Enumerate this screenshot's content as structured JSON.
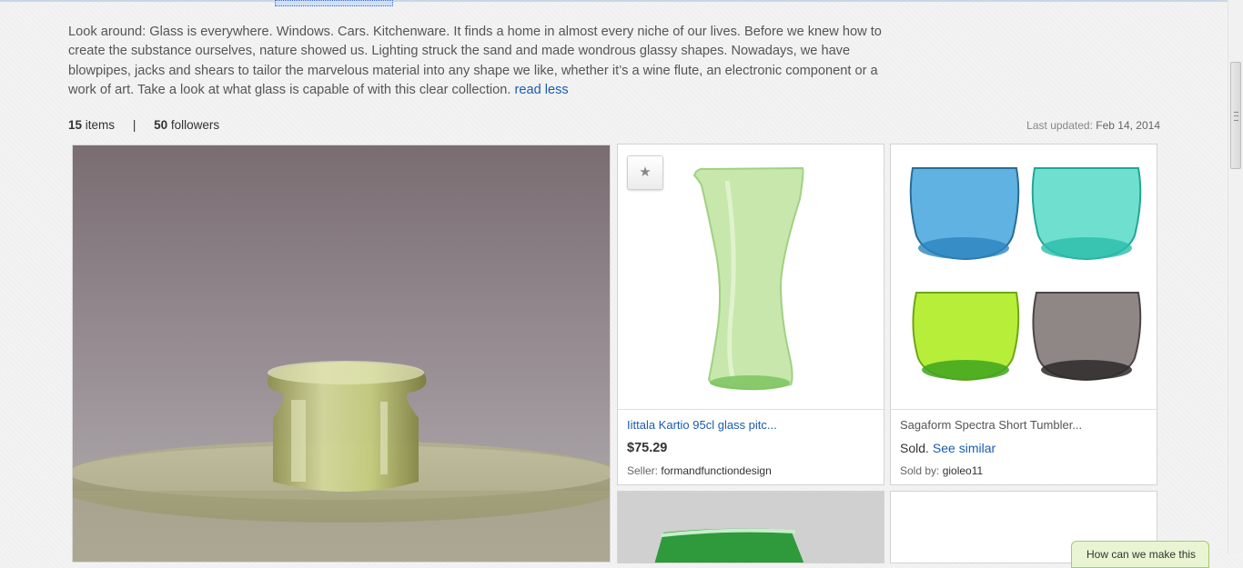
{
  "description": {
    "text": "Look around: Glass is everywhere. Windows. Cars. Kitchenware. It finds a home in almost every niche of our lives. Before we knew how to create the substance ourselves, nature showed us. Lighting struck the sand and made wondrous glassy shapes. Nowadays, we have blowpipes, jacks and shears to tailor the marvelous material into any shape we like, whether it’s a wine flute, an electronic component or a work of art. Take a look at what glass is capable of with this clear collection.",
    "toggle_label": "read less"
  },
  "stats": {
    "items_count": "15",
    "items_label": "items",
    "separator": "|",
    "followers_count": "50",
    "followers_label": "followers"
  },
  "updated": {
    "label": "Last updated",
    "colon": ":",
    "date": "Feb 14, 2014"
  },
  "hero": {
    "alt": "green glass candle holder"
  },
  "items": [
    {
      "title": "Iittala Kartio 95cl glass pitc...",
      "price": "$75.29",
      "seller_label": "Seller:",
      "seller": "formandfunctiondesign",
      "star_icon": "star-icon"
    },
    {
      "title": "Sagaform Spectra Short Tumbler...",
      "status": "Sold.",
      "see_similar": "See similar",
      "seller_label": "Sold by:",
      "seller": "gioleo11"
    }
  ],
  "feedback": {
    "label": "How can we make this"
  },
  "colors": {
    "link": "#1a5cb0",
    "background": "#f3f3f3"
  }
}
